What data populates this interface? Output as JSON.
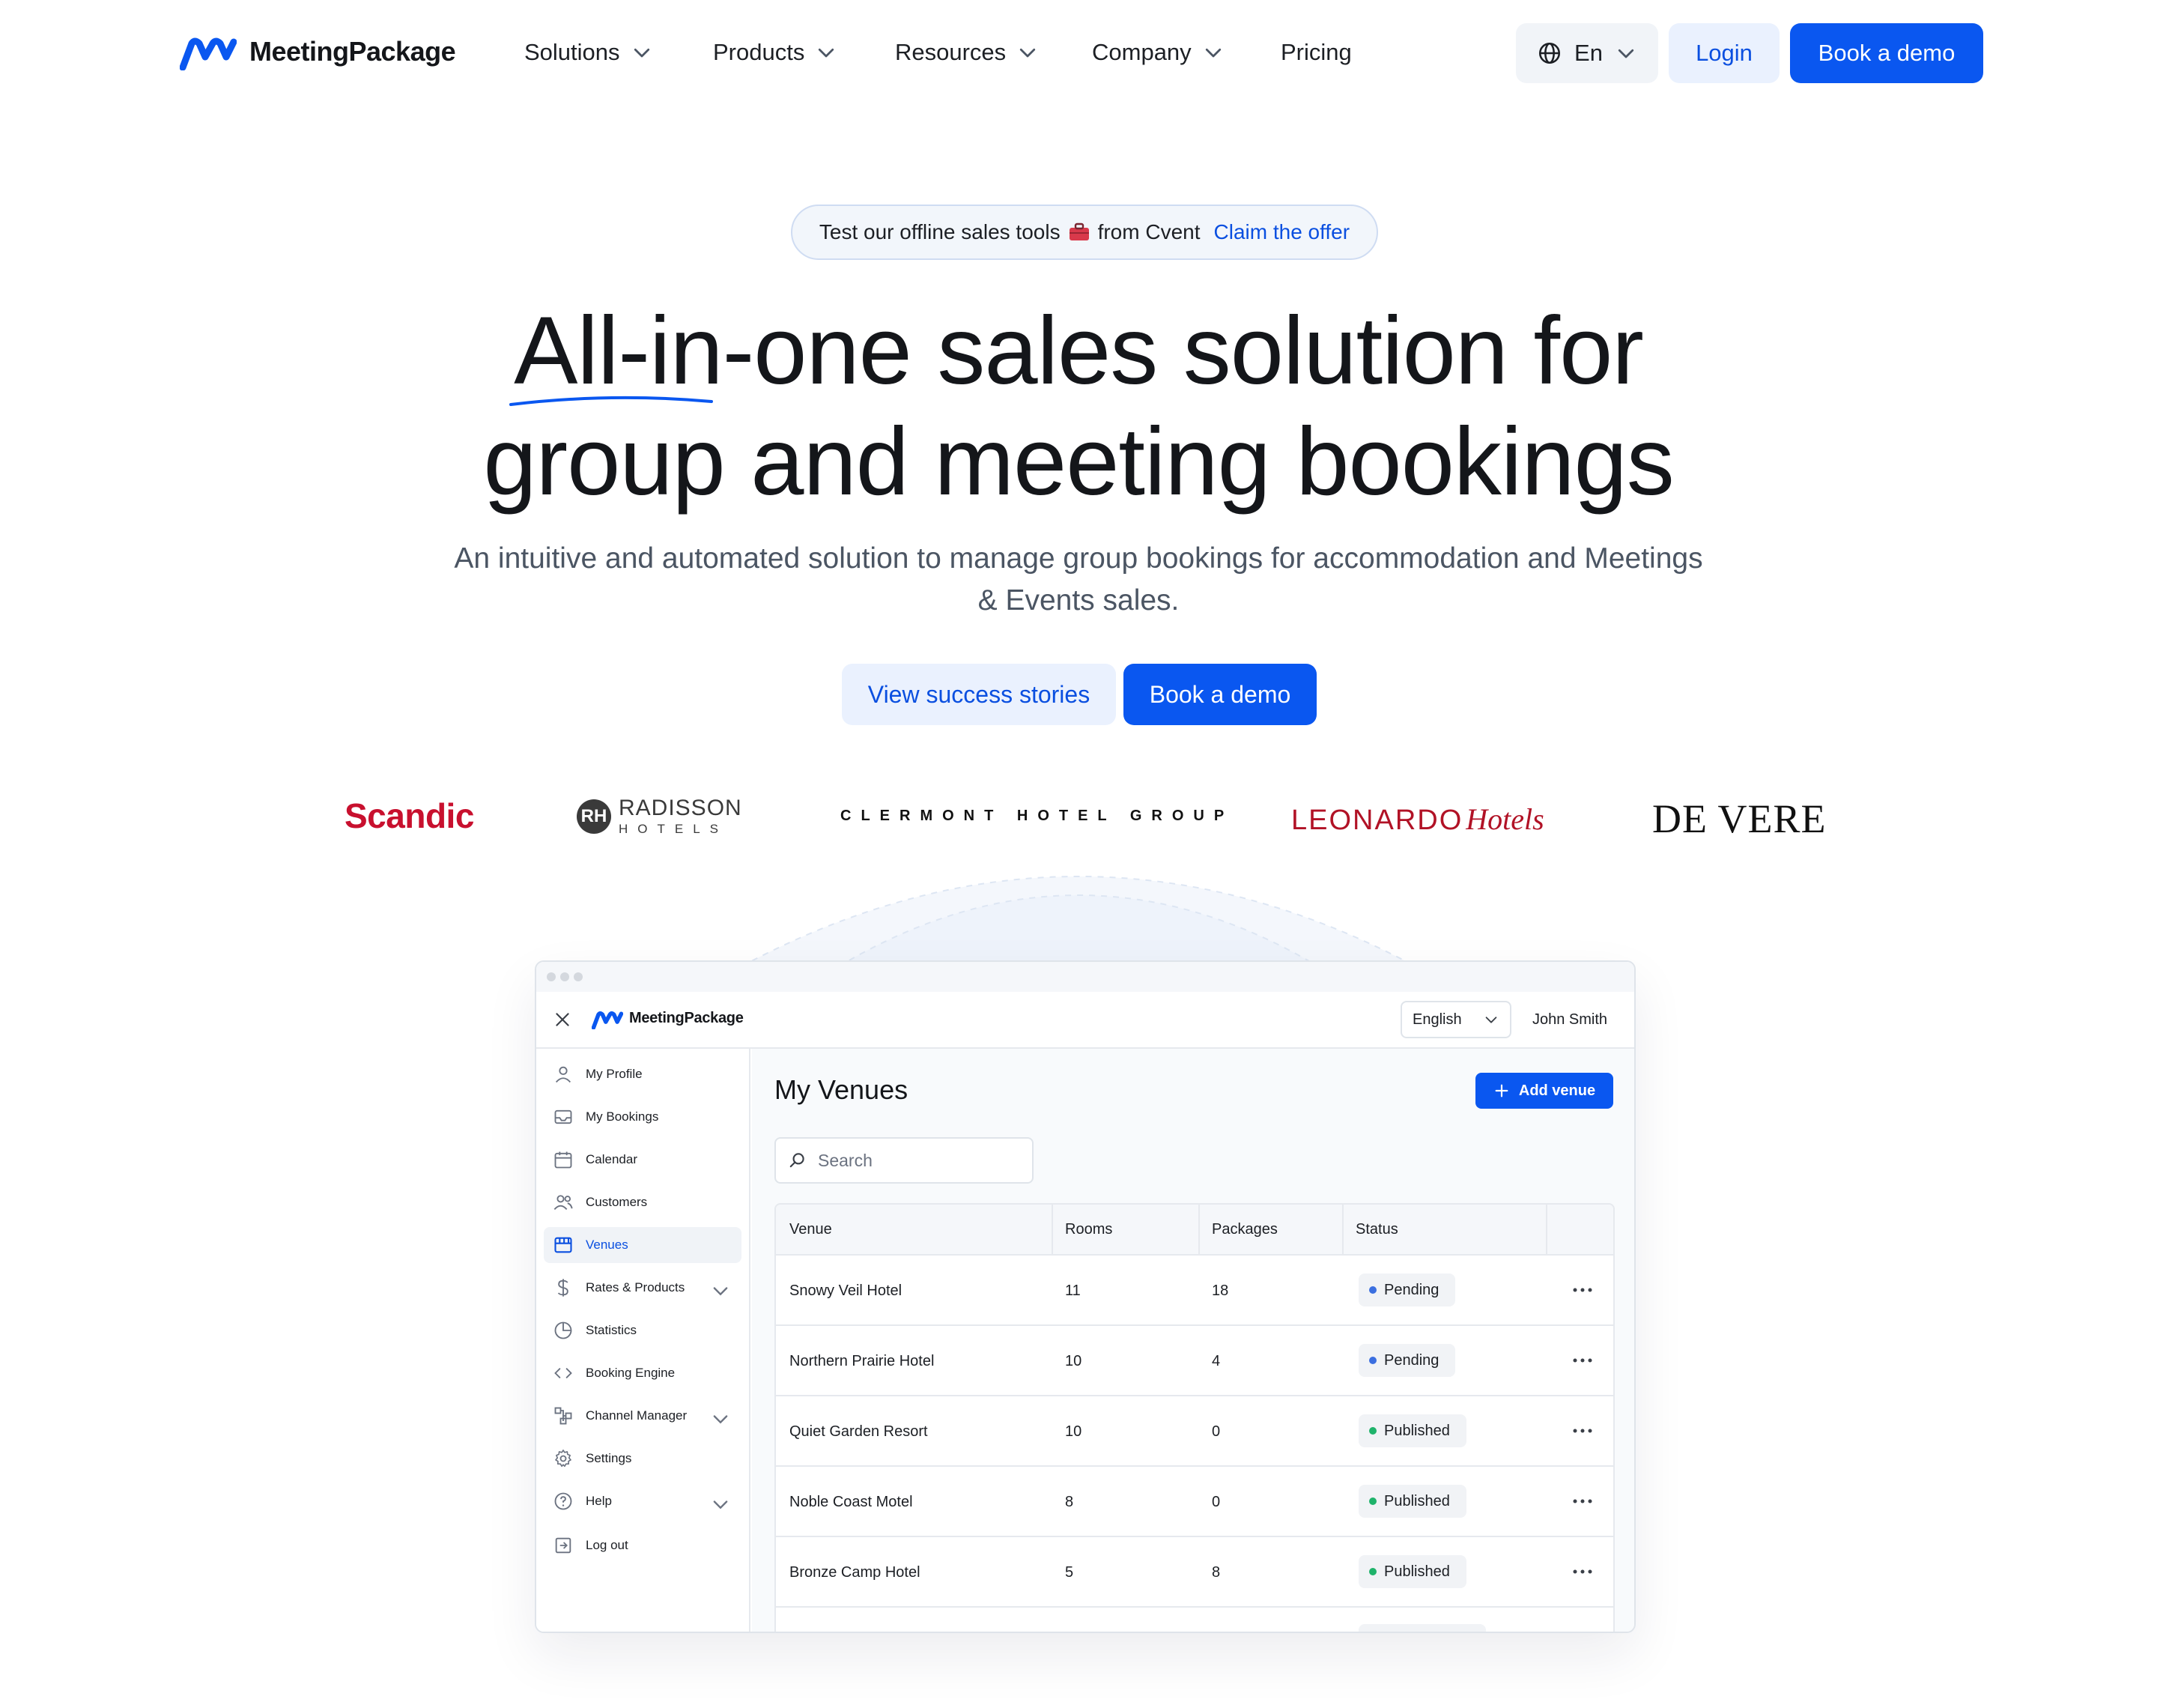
{
  "brand": {
    "name": "MeetingPackage",
    "color": "#0a57f0"
  },
  "nav": {
    "items": [
      {
        "label": "Solutions",
        "has_dropdown": true
      },
      {
        "label": "Products",
        "has_dropdown": true
      },
      {
        "label": "Resources",
        "has_dropdown": true
      },
      {
        "label": "Company",
        "has_dropdown": true
      },
      {
        "label": "Pricing",
        "has_dropdown": false
      }
    ],
    "language": "En",
    "login_label": "Login",
    "demo_label": "Book a demo"
  },
  "offer": {
    "text": "Test our offline sales tools",
    "icon": "briefcase-icon",
    "suffix": "from Cvent",
    "link": "Claim the offer"
  },
  "hero": {
    "title_line1": "All-in-one sales solution for",
    "title_line2": "group and meeting bookings",
    "subtitle": "An intuitive and automated solution to manage group bookings for accommodation and Meetings & Events sales.",
    "secondary_cta": "View success stories",
    "primary_cta": "Book a demo"
  },
  "customers": {
    "scandic": "Scandic",
    "radisson_mark": "RH",
    "radisson_name": "RADISSON",
    "radisson_sub": "HOTELS",
    "clermont": "CLERMONT HOTEL GROUP",
    "leonardo_name": "LEONARDO",
    "leonardo_sub": "Hotels",
    "devere": "DE VERE"
  },
  "app": {
    "logo": "MeetingPackage",
    "language": "English",
    "user": "John Smith",
    "sidebar": [
      {
        "label": "My Profile",
        "icon": "user-icon",
        "active": false,
        "expandable": false
      },
      {
        "label": "My Bookings",
        "icon": "inbox-icon",
        "active": false,
        "expandable": false
      },
      {
        "label": "Calendar",
        "icon": "calendar-icon",
        "active": false,
        "expandable": false
      },
      {
        "label": "Customers",
        "icon": "users-icon",
        "active": false,
        "expandable": false
      },
      {
        "label": "Venues",
        "icon": "store-icon",
        "active": true,
        "expandable": false
      },
      {
        "label": "Rates & Products",
        "icon": "dollar-icon",
        "active": false,
        "expandable": true
      },
      {
        "label": "Statistics",
        "icon": "pie-chart-icon",
        "active": false,
        "expandable": false
      },
      {
        "label": "Booking Engine",
        "icon": "code-icon",
        "active": false,
        "expandable": false
      },
      {
        "label": "Channel Manager",
        "icon": "network-icon",
        "active": false,
        "expandable": true
      },
      {
        "label": "Settings",
        "icon": "gear-icon",
        "active": false,
        "expandable": false
      },
      {
        "label": "Help",
        "icon": "help-icon",
        "active": false,
        "expandable": true
      },
      {
        "label": "Log out",
        "icon": "logout-icon",
        "active": false,
        "expandable": false
      }
    ],
    "main": {
      "title": "My Venues",
      "add_button": "Add venue",
      "search_placeholder": "Search",
      "columns": [
        "Venue",
        "Rooms",
        "Packages",
        "Status"
      ],
      "rows": [
        {
          "venue": "Snowy Veil Hotel",
          "rooms": "11",
          "packages": "18",
          "status": "Pending"
        },
        {
          "venue": "Northern Prairie Hotel",
          "rooms": "10",
          "packages": "4",
          "status": "Pending"
        },
        {
          "venue": "Quiet Garden Resort",
          "rooms": "10",
          "packages": "0",
          "status": "Published"
        },
        {
          "venue": "Noble Coast Motel",
          "rooms": "8",
          "packages": "0",
          "status": "Published"
        },
        {
          "venue": "Bronze Camp Hotel",
          "rooms": "5",
          "packages": "8",
          "status": "Published"
        }
      ],
      "status_colors": {
        "Pending": "#3b6fe0",
        "Published": "#1fb36b"
      }
    }
  }
}
